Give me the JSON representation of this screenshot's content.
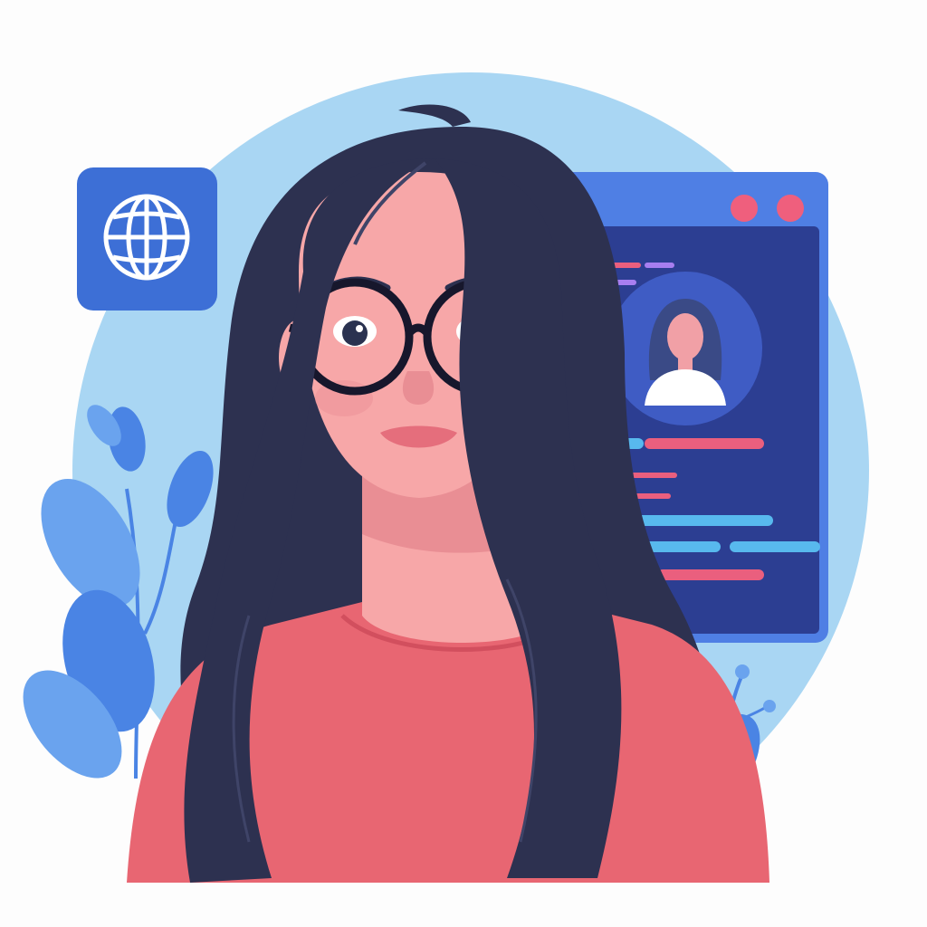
{
  "colors": {
    "page_background": "#fdfdfd",
    "backdrop_circle": "#a9d6f3",
    "globe_tile": "#3d6fd6",
    "globe_glyph": "#ffffff",
    "browser_frame": "#4f7fe4",
    "browser_body": "#2c3e92",
    "window_dot": "#ef5f7d",
    "profile_circle": "#3f5cc4",
    "avatar_hair": "#3a4a86",
    "avatar_skin": "#f1a0a6",
    "avatar_shirt": "#ffffff",
    "code_pink": "#ea5f7e",
    "code_blue": "#58b9ee",
    "code_violet": "#a77ef0",
    "leaf_blue": "#4a84e4",
    "leaf_light": "#6aa3ee",
    "hair": "#2d3150",
    "hair_shine": "#3f4468",
    "skin": "#f7a7a8",
    "skin_shadow": "#e98e94",
    "glasses": "#17172c",
    "eyes": "#2a3250",
    "lips": "#e56e7c",
    "shirt": "#e86672",
    "shirt_shadow": "#d24f5e"
  },
  "icons": {
    "globe": "globe-icon",
    "window_controls": "window-control-dot-icon"
  },
  "illustration": {
    "subject": "woman-with-glasses",
    "scene": "developer-profile-screen"
  }
}
